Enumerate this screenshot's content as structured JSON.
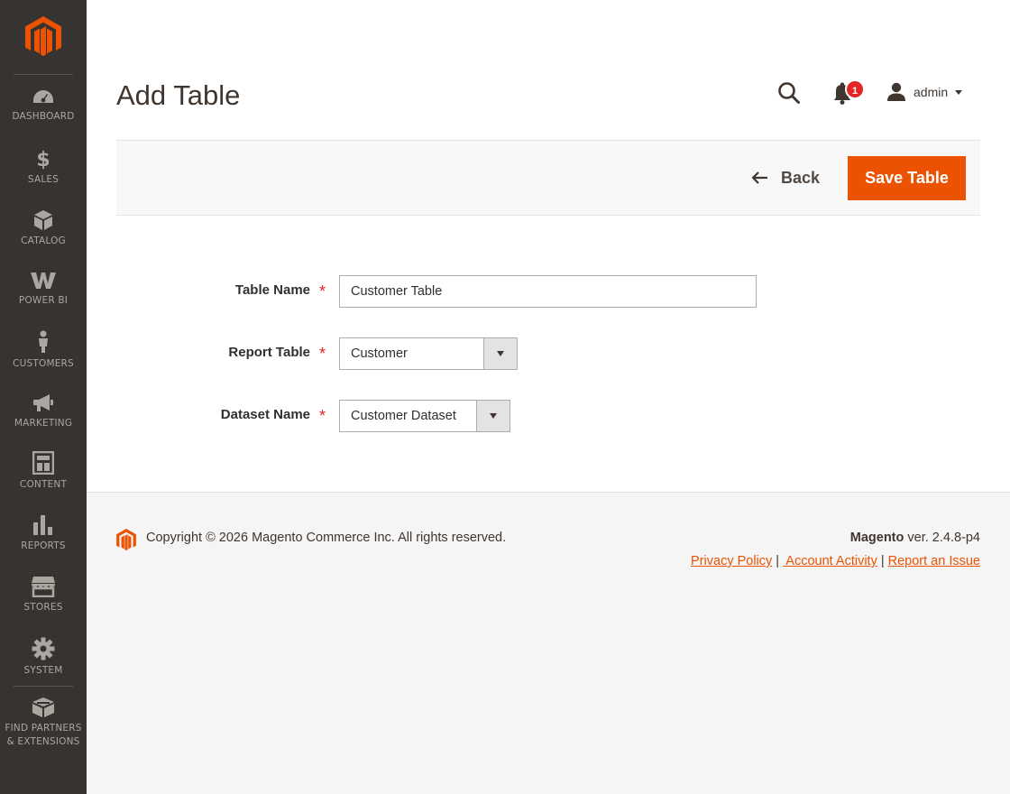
{
  "sidebar": {
    "items": [
      {
        "label": "DASHBOARD",
        "icon": "dashboard-icon"
      },
      {
        "label": "SALES",
        "icon": "dollar-icon"
      },
      {
        "label": "CATALOG",
        "icon": "cube-icon"
      },
      {
        "label": "POWER BI",
        "icon": "powerbi-icon"
      },
      {
        "label": "CUSTOMERS",
        "icon": "person-icon"
      },
      {
        "label": "MARKETING",
        "icon": "megaphone-icon"
      },
      {
        "label": "CONTENT",
        "icon": "layout-icon"
      },
      {
        "label": "REPORTS",
        "icon": "bar-chart-icon"
      },
      {
        "label": "STORES",
        "icon": "storefront-icon"
      },
      {
        "label": "SYSTEM",
        "icon": "gear-icon"
      },
      {
        "label": "FIND PARTNERS & EXTENSIONS",
        "icon": "box-icon"
      }
    ]
  },
  "header": {
    "title": "Add Table",
    "notifications_count": "1",
    "user_name": "admin"
  },
  "actions": {
    "back_label": "Back",
    "save_label": "Save Table"
  },
  "form": {
    "table_name_label": "Table Name",
    "table_name_value": "Customer Table",
    "report_table_label": "Report Table",
    "report_table_value": "Customer",
    "dataset_name_label": "Dataset Name",
    "dataset_name_value": "Customer Dataset",
    "required_mark": "*"
  },
  "footer": {
    "copyright": "Copyright © 2026 Magento Commerce Inc. All rights reserved.",
    "brand": "Magento",
    "version": " ver. 2.4.8-p4",
    "links": [
      "Privacy Policy",
      " Account Activity",
      "Report an Issue"
    ],
    "separator": "|"
  },
  "colors": {
    "accent": "#eb5202",
    "sidebar_bg": "#373330",
    "badge": "#e22626"
  }
}
